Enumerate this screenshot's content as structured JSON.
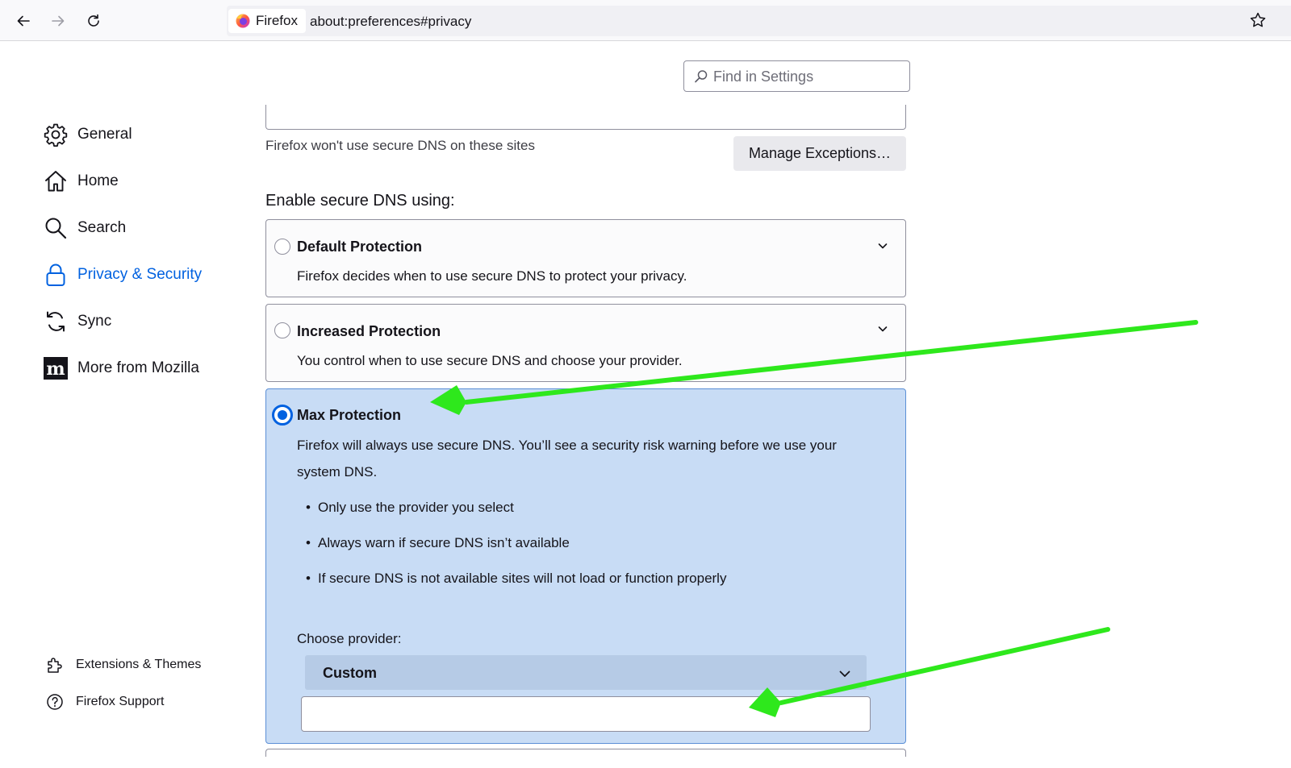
{
  "browser": {
    "identity_label": "Firefox",
    "url": "about:preferences#privacy"
  },
  "search": {
    "placeholder": "Find in Settings"
  },
  "sidebar": {
    "items": [
      {
        "label": "General",
        "icon": "gear-icon"
      },
      {
        "label": "Home",
        "icon": "home-icon"
      },
      {
        "label": "Search",
        "icon": "search-icon"
      },
      {
        "label": "Privacy & Security",
        "icon": "lock-icon",
        "active": true
      },
      {
        "label": "Sync",
        "icon": "sync-icon"
      },
      {
        "label": "More from Mozilla",
        "icon": "mozilla-logo-icon"
      }
    ],
    "footer": [
      {
        "label": "Extensions & Themes",
        "icon": "puzzle-piece-icon"
      },
      {
        "label": "Firefox Support",
        "icon": "help-icon"
      }
    ]
  },
  "dns": {
    "exceptions_text": "Firefox won't use secure DNS on these sites",
    "manage_exceptions_label": "Manage Exceptions…",
    "heading": "Enable secure DNS using:",
    "options": [
      {
        "title": "Default Protection",
        "description": "Firefox decides when to use secure DNS to protect your privacy.",
        "selected": false
      },
      {
        "title": "Increased Protection",
        "description": "You control when to use secure DNS and choose your provider.",
        "selected": false
      },
      {
        "title": "Max Protection",
        "description_line1": "Firefox will always use secure DNS. You’ll see a security risk warning before we use your",
        "description_line2": "system DNS.",
        "bullets": [
          "Only use the provider you select",
          "Always warn if secure DNS isn’t available",
          "If secure DNS is not available sites will not load or function properly"
        ],
        "selected": true
      }
    ],
    "choose_provider_label": "Choose provider:",
    "provider_selected": "Custom",
    "custom_provider_value": ""
  },
  "colors": {
    "accent": "#0061e0",
    "selected_card_bg": "#c8dcf5",
    "annotation_arrow": "#2ee81c"
  }
}
